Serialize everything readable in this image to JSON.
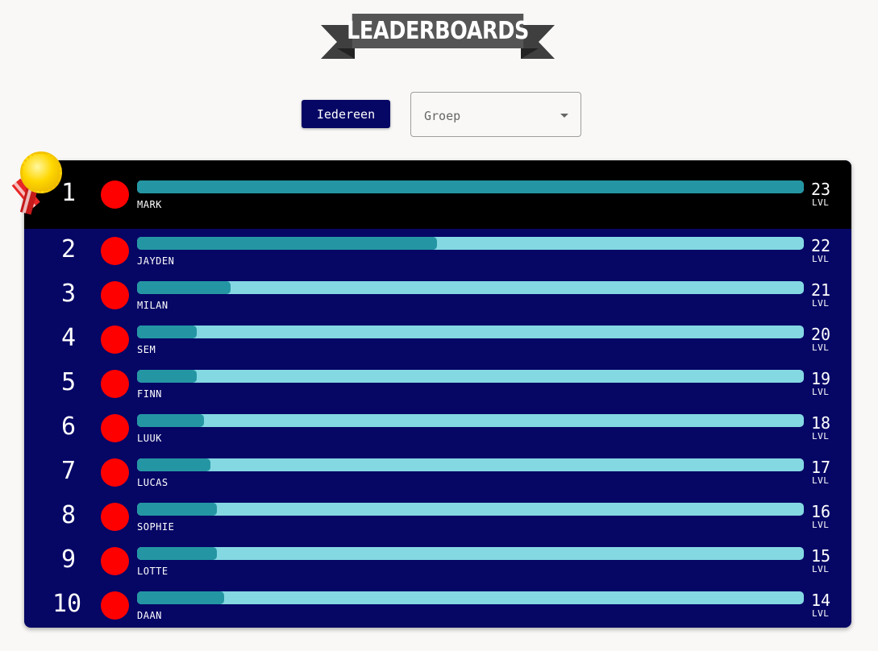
{
  "title": "LEADERBOARDS",
  "controls": {
    "all_button": "Iedereen",
    "group_select_placeholder": "Groep"
  },
  "lvl_label": "LVL",
  "players": [
    {
      "rank": "1",
      "name": "MARK",
      "level": "23",
      "progress": 1.0
    },
    {
      "rank": "2",
      "name": "JAYDEN",
      "level": "22",
      "progress": 0.45
    },
    {
      "rank": "3",
      "name": "MILAN",
      "level": "21",
      "progress": 0.14
    },
    {
      "rank": "4",
      "name": "SEM",
      "level": "20",
      "progress": 0.09
    },
    {
      "rank": "5",
      "name": "FINN",
      "level": "19",
      "progress": 0.09
    },
    {
      "rank": "6",
      "name": "LUUK",
      "level": "18",
      "progress": 0.1
    },
    {
      "rank": "7",
      "name": "LUCAS",
      "level": "17",
      "progress": 0.11
    },
    {
      "rank": "8",
      "name": "SOPHIE",
      "level": "16",
      "progress": 0.12
    },
    {
      "rank": "9",
      "name": "LOTTE",
      "level": "15",
      "progress": 0.12
    },
    {
      "rank": "10",
      "name": "DAAN",
      "level": "14",
      "progress": 0.13
    }
  ],
  "colors": {
    "board": "#060665",
    "first_row": "#000000",
    "bar_track": "#84d8e2",
    "bar_fill": "#2496a3",
    "avatar": "#ff0000"
  },
  "icons": {
    "first_place": "gold-medal-icon",
    "avatar": "avatar-circle"
  }
}
